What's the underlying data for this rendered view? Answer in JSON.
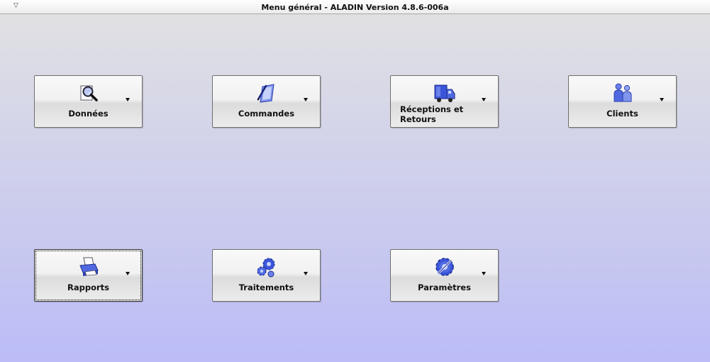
{
  "window": {
    "title": "Menu général - ALADIN Version 4.8.6-006a",
    "menu_glyph": "▽"
  },
  "tiles": [
    {
      "label": "Données",
      "icon": "magnifier-document-icon"
    },
    {
      "label": "Commandes",
      "icon": "clipboard-pen-icon"
    },
    {
      "label": "Réceptions et Retours",
      "icon": "truck-icon"
    },
    {
      "label": "Clients",
      "icon": "people-icon"
    },
    {
      "label": "Rapports",
      "icon": "printer-icon",
      "focused": true
    },
    {
      "label": "Traitements",
      "icon": "gears-icon"
    },
    {
      "label": "Paramètres",
      "icon": "wrench-gear-icon"
    }
  ],
  "colors": {
    "icon_blue": "#3a55d8",
    "icon_light": "#8fa3f2",
    "bg_top": "#e2e2e2",
    "bg_bottom": "#bbbcf8"
  }
}
